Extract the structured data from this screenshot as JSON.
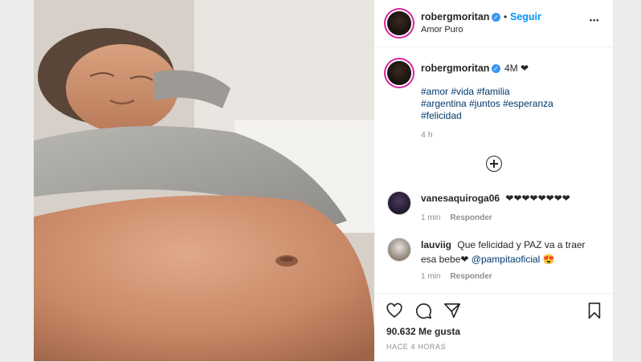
{
  "post": {
    "author": "robergmoritan",
    "follow_label": "Seguir",
    "separator": "•",
    "location": "Amor Puro",
    "more_label": "•••"
  },
  "caption": {
    "author": "robergmoritan",
    "text": "4M ❤",
    "hashtags": [
      "#amor #vida #familia",
      "#argentina #juntos #esperanza",
      "#felicidad"
    ],
    "time": "4 h"
  },
  "comments": [
    {
      "user": "vanesaquiroga06",
      "text": "❤❤❤❤❤❤❤❤",
      "time": "1 min",
      "reply": "Responder"
    },
    {
      "user": "lauviig",
      "text_line1": "Que felicidad y PAZ va a traer",
      "text_line2_prefix": "esa bebe❤ ",
      "mention": "@pampitaoficial",
      "emoji": "😍",
      "time": "1 min",
      "reply": "Responder"
    }
  ],
  "footer": {
    "likes": "90.632 Me gusta",
    "ago": "HACE 4 HORAS"
  },
  "colors": {
    "accent": "#0095f6",
    "verified": "#3897f0",
    "hashtag": "#00376b"
  }
}
